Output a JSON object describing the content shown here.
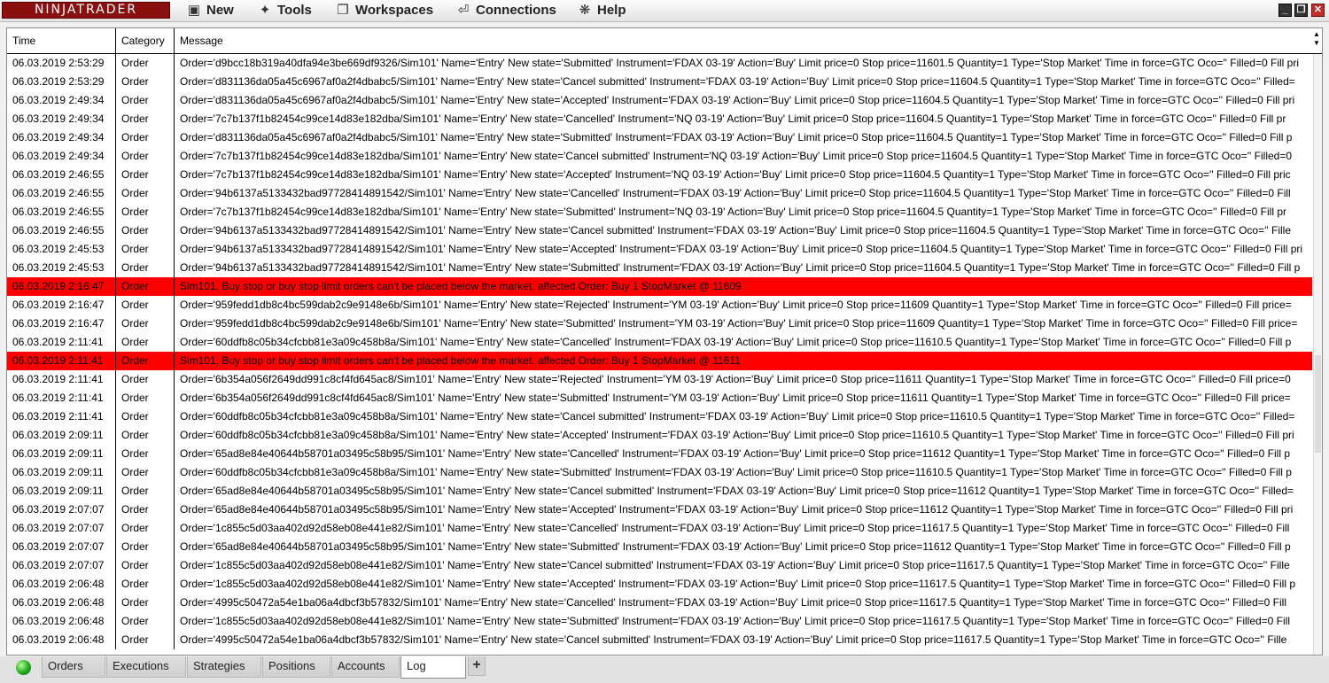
{
  "menubar": {
    "logo_text": "NINJATRADER",
    "items": [
      {
        "label": "New",
        "icon": "new-window-icon"
      },
      {
        "label": "Tools",
        "icon": "tools-icon"
      },
      {
        "label": "Workspaces",
        "icon": "workspaces-icon"
      },
      {
        "label": "Connections",
        "icon": "connections-plug-icon"
      },
      {
        "label": "Help",
        "icon": "help-icon"
      }
    ]
  },
  "grid": {
    "columns": {
      "time": "Time",
      "category": "Category",
      "message": "Message"
    },
    "rows": [
      {
        "time": "06.03.2019 2:53:29",
        "category": "Order",
        "message": "Order='d9bcc18b319a40dfa94e3be669df9326/Sim101' Name='Entry' New state='Submitted' Instrument='FDAX 03-19' Action='Buy' Limit price=0 Stop price=11601.5 Quantity=1 Type='Stop Market' Time in force=GTC Oco='' Filled=0 Fill pri"
      },
      {
        "time": "06.03.2019 2:53:29",
        "category": "Order",
        "message": "Order='d831136da05a45c6967af0a2f4dbabc5/Sim101' Name='Entry' New state='Cancel submitted' Instrument='FDAX 03-19' Action='Buy' Limit price=0 Stop price=11604.5 Quantity=1 Type='Stop Market' Time in force=GTC Oco='' Filled="
      },
      {
        "time": "06.03.2019 2:49:34",
        "category": "Order",
        "message": "Order='d831136da05a45c6967af0a2f4dbabc5/Sim101' Name='Entry' New state='Accepted' Instrument='FDAX 03-19' Action='Buy' Limit price=0 Stop price=11604.5 Quantity=1 Type='Stop Market' Time in force=GTC Oco='' Filled=0 Fill pri"
      },
      {
        "time": "06.03.2019 2:49:34",
        "category": "Order",
        "message": "Order='7c7b137f1b82454c99ce14d83e182dba/Sim101' Name='Entry' New state='Cancelled' Instrument='NQ 03-19' Action='Buy' Limit price=0 Stop price=11604.5 Quantity=1 Type='Stop Market' Time in force=GTC Oco='' Filled=0 Fill pr"
      },
      {
        "time": "06.03.2019 2:49:34",
        "category": "Order",
        "message": "Order='d831136da05a45c6967af0a2f4dbabc5/Sim101' Name='Entry' New state='Submitted' Instrument='FDAX 03-19' Action='Buy' Limit price=0 Stop price=11604.5 Quantity=1 Type='Stop Market' Time in force=GTC Oco='' Filled=0 Fill p"
      },
      {
        "time": "06.03.2019 2:49:34",
        "category": "Order",
        "message": "Order='7c7b137f1b82454c99ce14d83e182dba/Sim101' Name='Entry' New state='Cancel submitted' Instrument='NQ 03-19' Action='Buy' Limit price=0 Stop price=11604.5 Quantity=1 Type='Stop Market' Time in force=GTC Oco='' Filled=0"
      },
      {
        "time": "06.03.2019 2:46:55",
        "category": "Order",
        "message": "Order='7c7b137f1b82454c99ce14d83e182dba/Sim101' Name='Entry' New state='Accepted' Instrument='NQ 03-19' Action='Buy' Limit price=0 Stop price=11604.5 Quantity=1 Type='Stop Market' Time in force=GTC Oco='' Filled=0 Fill pric"
      },
      {
        "time": "06.03.2019 2:46:55",
        "category": "Order",
        "message": "Order='94b6137a5133432bad97728414891542/Sim101' Name='Entry' New state='Cancelled' Instrument='FDAX 03-19' Action='Buy' Limit price=0 Stop price=11604.5 Quantity=1 Type='Stop Market' Time in force=GTC Oco='' Filled=0 Fill"
      },
      {
        "time": "06.03.2019 2:46:55",
        "category": "Order",
        "message": "Order='7c7b137f1b82454c99ce14d83e182dba/Sim101' Name='Entry' New state='Submitted' Instrument='NQ 03-19' Action='Buy' Limit price=0 Stop price=11604.5 Quantity=1 Type='Stop Market' Time in force=GTC Oco='' Filled=0 Fill pr"
      },
      {
        "time": "06.03.2019 2:46:55",
        "category": "Order",
        "message": "Order='94b6137a5133432bad97728414891542/Sim101' Name='Entry' New state='Cancel submitted' Instrument='FDAX 03-19' Action='Buy' Limit price=0 Stop price=11604.5 Quantity=1 Type='Stop Market' Time in force=GTC Oco='' Fille"
      },
      {
        "time": "06.03.2019 2:45:53",
        "category": "Order",
        "message": "Order='94b6137a5133432bad97728414891542/Sim101' Name='Entry' New state='Accepted' Instrument='FDAX 03-19' Action='Buy' Limit price=0 Stop price=11604.5 Quantity=1 Type='Stop Market' Time in force=GTC Oco='' Filled=0 Fill pri"
      },
      {
        "time": "06.03.2019 2:45:53",
        "category": "Order",
        "message": "Order='94b6137a5133432bad97728414891542/Sim101' Name='Entry' New state='Submitted' Instrument='FDAX 03-19' Action='Buy' Limit price=0 Stop price=11604.5 Quantity=1 Type='Stop Market' Time in force=GTC Oco='' Filled=0 Fill p"
      },
      {
        "time": "06.03.2019 2:16:47",
        "category": "Order",
        "message": "Sim101, Buy stop or buy stop limit orders can't be placed below the market. affected Order: Buy 1 StopMarket @ 11609",
        "error": true
      },
      {
        "time": "06.03.2019 2:16:47",
        "category": "Order",
        "message": "Order='959fedd1db8c4bc599dab2c9e9148e6b/Sim101' Name='Entry' New state='Rejected' Instrument='YM 03-19' Action='Buy' Limit price=0 Stop price=11609 Quantity=1 Type='Stop Market' Time in force=GTC Oco='' Filled=0 Fill price="
      },
      {
        "time": "06.03.2019 2:16:47",
        "category": "Order",
        "message": "Order='959fedd1db8c4bc599dab2c9e9148e6b/Sim101' Name='Entry' New state='Submitted' Instrument='YM 03-19' Action='Buy' Limit price=0 Stop price=11609 Quantity=1 Type='Stop Market' Time in force=GTC Oco='' Filled=0 Fill price="
      },
      {
        "time": "06.03.2019 2:11:41",
        "category": "Order",
        "message": "Order='60ddfb8c05b34cfcbb81e3a09c458b8a/Sim101' Name='Entry' New state='Cancelled' Instrument='FDAX 03-19' Action='Buy' Limit price=0 Stop price=11610.5 Quantity=1 Type='Stop Market' Time in force=GTC Oco='' Filled=0 Fill p"
      },
      {
        "time": "06.03.2019 2:11:41",
        "category": "Order",
        "message": "Sim101, Buy stop or buy stop limit orders can't be placed below the market. affected Order: Buy 1 StopMarket @ 11611",
        "error": true
      },
      {
        "time": "06.03.2019 2:11:41",
        "category": "Order",
        "message": "Order='6b354a056f2649dd991c8cf4fd645ac8/Sim101' Name='Entry' New state='Rejected' Instrument='YM 03-19' Action='Buy' Limit price=0 Stop price=11611 Quantity=1 Type='Stop Market' Time in force=GTC Oco='' Filled=0 Fill price=0"
      },
      {
        "time": "06.03.2019 2:11:41",
        "category": "Order",
        "message": "Order='6b354a056f2649dd991c8cf4fd645ac8/Sim101' Name='Entry' New state='Submitted' Instrument='YM 03-19' Action='Buy' Limit price=0 Stop price=11611 Quantity=1 Type='Stop Market' Time in force=GTC Oco='' Filled=0 Fill price="
      },
      {
        "time": "06.03.2019 2:11:41",
        "category": "Order",
        "message": "Order='60ddfb8c05b34cfcbb81e3a09c458b8a/Sim101' Name='Entry' New state='Cancel submitted' Instrument='FDAX 03-19' Action='Buy' Limit price=0 Stop price=11610.5 Quantity=1 Type='Stop Market' Time in force=GTC Oco='' Filled="
      },
      {
        "time": "06.03.2019 2:09:11",
        "category": "Order",
        "message": "Order='60ddfb8c05b34cfcbb81e3a09c458b8a/Sim101' Name='Entry' New state='Accepted' Instrument='FDAX 03-19' Action='Buy' Limit price=0 Stop price=11610.5 Quantity=1 Type='Stop Market' Time in force=GTC Oco='' Filled=0 Fill pri"
      },
      {
        "time": "06.03.2019 2:09:11",
        "category": "Order",
        "message": "Order='65ad8e84e40644b58701a03495c58b95/Sim101' Name='Entry' New state='Cancelled' Instrument='FDAX 03-19' Action='Buy' Limit price=0 Stop price=11612 Quantity=1 Type='Stop Market' Time in force=GTC Oco='' Filled=0 Fill p"
      },
      {
        "time": "06.03.2019 2:09:11",
        "category": "Order",
        "message": "Order='60ddfb8c05b34cfcbb81e3a09c458b8a/Sim101' Name='Entry' New state='Submitted' Instrument='FDAX 03-19' Action='Buy' Limit price=0 Stop price=11610.5 Quantity=1 Type='Stop Market' Time in force=GTC Oco='' Filled=0 Fill p"
      },
      {
        "time": "06.03.2019 2:09:11",
        "category": "Order",
        "message": "Order='65ad8e84e40644b58701a03495c58b95/Sim101' Name='Entry' New state='Cancel submitted' Instrument='FDAX 03-19' Action='Buy' Limit price=0 Stop price=11612 Quantity=1 Type='Stop Market' Time in force=GTC Oco='' Filled="
      },
      {
        "time": "06.03.2019 2:07:07",
        "category": "Order",
        "message": "Order='65ad8e84e40644b58701a03495c58b95/Sim101' Name='Entry' New state='Accepted' Instrument='FDAX 03-19' Action='Buy' Limit price=0 Stop price=11612 Quantity=1 Type='Stop Market' Time in force=GTC Oco='' Filled=0 Fill pri"
      },
      {
        "time": "06.03.2019 2:07:07",
        "category": "Order",
        "message": "Order='1c855c5d03aa402d92d58eb08e441e82/Sim101' Name='Entry' New state='Cancelled' Instrument='FDAX 03-19' Action='Buy' Limit price=0 Stop price=11617.5 Quantity=1 Type='Stop Market' Time in force=GTC Oco='' Filled=0 Fill"
      },
      {
        "time": "06.03.2019 2:07:07",
        "category": "Order",
        "message": "Order='65ad8e84e40644b58701a03495c58b95/Sim101' Name='Entry' New state='Submitted' Instrument='FDAX 03-19' Action='Buy' Limit price=0 Stop price=11612 Quantity=1 Type='Stop Market' Time in force=GTC Oco='' Filled=0 Fill p"
      },
      {
        "time": "06.03.2019 2:07:07",
        "category": "Order",
        "message": "Order='1c855c5d03aa402d92d58eb08e441e82/Sim101' Name='Entry' New state='Cancel submitted' Instrument='FDAX 03-19' Action='Buy' Limit price=0 Stop price=11617.5 Quantity=1 Type='Stop Market' Time in force=GTC Oco='' Fille"
      },
      {
        "time": "06.03.2019 2:06:48",
        "category": "Order",
        "message": "Order='1c855c5d03aa402d92d58eb08e441e82/Sim101' Name='Entry' New state='Accepted' Instrument='FDAX 03-19' Action='Buy' Limit price=0 Stop price=11617.5 Quantity=1 Type='Stop Market' Time in force=GTC Oco='' Filled=0 Fill p"
      },
      {
        "time": "06.03.2019 2:06:48",
        "category": "Order",
        "message": "Order='4995c50472a54e1ba06a4dbcf3b57832/Sim101' Name='Entry' New state='Cancelled' Instrument='FDAX 03-19' Action='Buy' Limit price=0 Stop price=11617.5 Quantity=1 Type='Stop Market' Time in force=GTC Oco='' Filled=0 Fill"
      },
      {
        "time": "06.03.2019 2:06:48",
        "category": "Order",
        "message": "Order='1c855c5d03aa402d92d58eb08e441e82/Sim101' Name='Entry' New state='Submitted' Instrument='FDAX 03-19' Action='Buy' Limit price=0 Stop price=11617.5 Quantity=1 Type='Stop Market' Time in force=GTC Oco='' Filled=0 Fill"
      },
      {
        "time": "06.03.2019 2:06:48",
        "category": "Order",
        "message": "Order='4995c50472a54e1ba06a4dbcf3b57832/Sim101' Name='Entry' New state='Cancel submitted' Instrument='FDAX 03-19' Action='Buy' Limit price=0 Stop price=11617.5 Quantity=1 Type='Stop Market' Time in force=GTC Oco='' Fille"
      }
    ]
  },
  "tabs": {
    "status_icon": "connection-status-green-icon",
    "items": [
      {
        "label": "Orders"
      },
      {
        "label": "Executions"
      },
      {
        "label": "Strategies"
      },
      {
        "label": "Positions"
      },
      {
        "label": "Accounts"
      },
      {
        "label": "Log",
        "active": true
      }
    ],
    "add_label": "+"
  },
  "colors": {
    "error_row": "#ff0000",
    "logo_bg": "#8a1010",
    "status_ok": "#1ea81e"
  }
}
